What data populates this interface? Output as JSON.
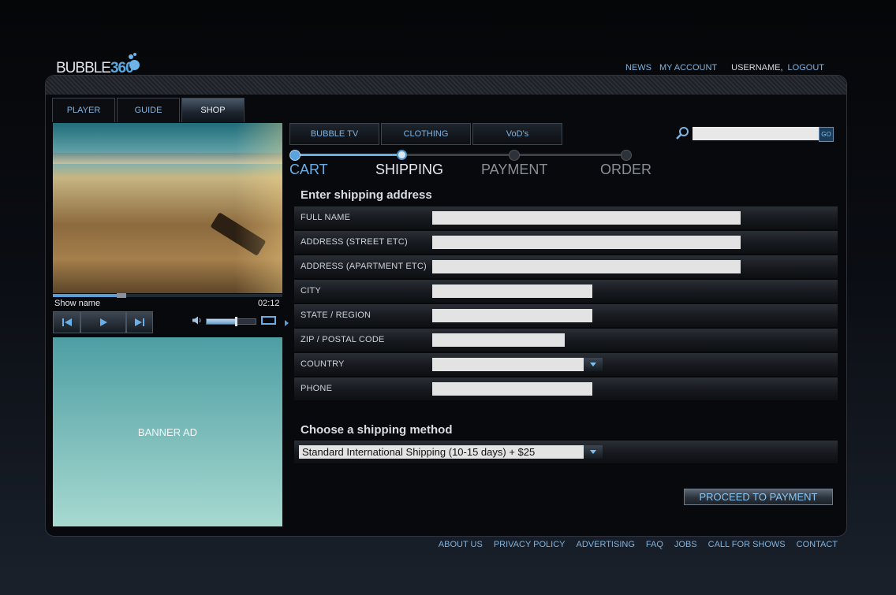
{
  "brand": {
    "name": "BUBBLE",
    "number": "360"
  },
  "topnav": {
    "news": "NEWS",
    "my_account": "MY ACCOUNT",
    "username": "USERNAME,",
    "logout": "LOGOUT"
  },
  "main_tabs": [
    "PLAYER",
    "GUIDE",
    "SHOP"
  ],
  "active_main_tab": "SHOP",
  "player": {
    "show_name": "Show name",
    "time": "02:12",
    "progress": 0.3,
    "volume": 0.6
  },
  "banner": {
    "text": "BANNER AD"
  },
  "shop_tabs": [
    "BUBBLE TV",
    "CLOTHING",
    "VoD's"
  ],
  "search": {
    "placeholder": "",
    "go_label": "GO"
  },
  "steps": [
    {
      "label": "CART",
      "state": "done"
    },
    {
      "label": "SHIPPING",
      "state": "current"
    },
    {
      "label": "PAYMENT",
      "state": "pending"
    },
    {
      "label": "ORDER",
      "state": "pending"
    }
  ],
  "form": {
    "title": "Enter shipping address",
    "fields": [
      {
        "label": "FULL NAME",
        "value": ""
      },
      {
        "label": "ADDRESS (STREET ETC)",
        "value": ""
      },
      {
        "label": "ADDRESS (APARTMENT ETC)",
        "value": ""
      },
      {
        "label": "CITY",
        "value": ""
      },
      {
        "label": "STATE / REGION",
        "value": ""
      },
      {
        "label": "ZIP / POSTAL CODE",
        "value": ""
      },
      {
        "label": "COUNTRY",
        "value": ""
      },
      {
        "label": "PHONE",
        "value": ""
      }
    ]
  },
  "shipping": {
    "title": "Choose a shipping method",
    "selected": "Standard International Shipping (10-15 days) + $25"
  },
  "proceed_label": "PROCEED TO PAYMENT",
  "footer_links": [
    "ABOUT US",
    "PRIVACY POLICY",
    "ADVERTISING",
    "FAQ",
    "JOBS",
    "CALL FOR SHOWS",
    "CONTACT"
  ],
  "colors": {
    "accent": "#7fb3e0",
    "active_step": "#6aaee6",
    "pending_step": "#8a8f96"
  }
}
